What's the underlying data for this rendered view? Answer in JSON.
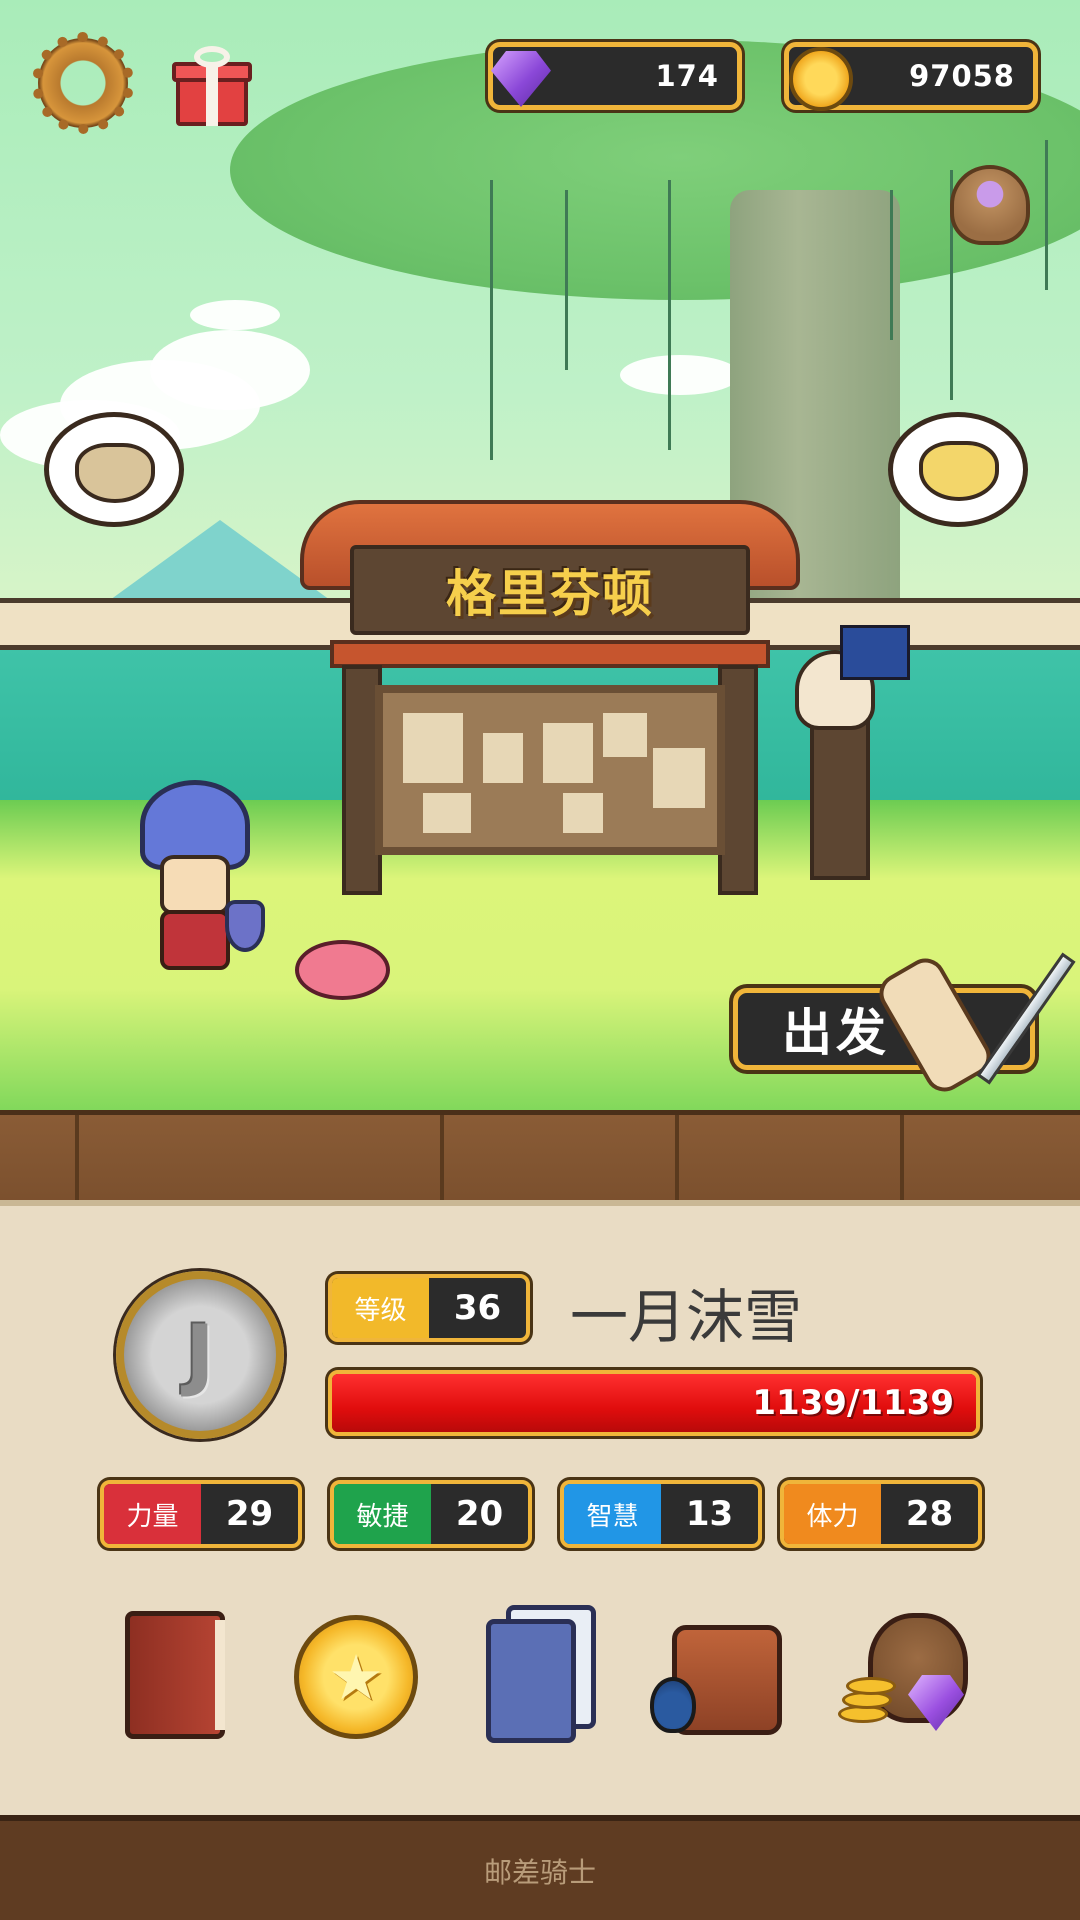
{
  "currencies": {
    "gems": "174",
    "coins": "97058"
  },
  "location": {
    "sign": "格里芬顿"
  },
  "depart_button": {
    "label": "出发"
  },
  "player": {
    "rank_letter": "J",
    "level_label": "等级",
    "level": "36",
    "name": "一月沫雪",
    "hp_text": "1139/1139",
    "hp_fraction": 1.0
  },
  "stats": [
    {
      "label": "力量",
      "value": "29",
      "color": "#d9303a"
    },
    {
      "label": "敏捷",
      "value": "20",
      "color": "#1fa34c"
    },
    {
      "label": "智慧",
      "value": "13",
      "color": "#2196e6"
    },
    {
      "label": "体力",
      "value": "28",
      "color": "#f08a1e"
    }
  ],
  "menu": [
    {
      "icon": "hero-book-icon"
    },
    {
      "icon": "star-coin-icon"
    },
    {
      "icon": "skill-cards-icon"
    },
    {
      "icon": "inventory-bag-icon"
    },
    {
      "icon": "treasure-pouch-icon"
    }
  ],
  "footer": {
    "title": "邮差骑士"
  },
  "colors": {
    "gold_border": "#f0b53a",
    "hp_red": "#e00d0d",
    "panel": "#e9dcc4"
  }
}
